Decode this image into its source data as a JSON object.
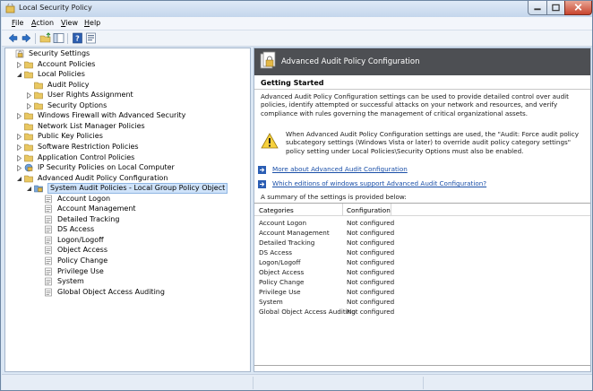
{
  "window": {
    "title": "Local Security Policy"
  },
  "menu": [
    {
      "label": "File",
      "accel": "F",
      "rest": "ile"
    },
    {
      "label": "Action",
      "accel": "A",
      "rest": "ction"
    },
    {
      "label": "View",
      "accel": "V",
      "rest": "iew"
    },
    {
      "label": "Help",
      "accel": "H",
      "rest": "elp"
    }
  ],
  "toolbar": {
    "icons": [
      "back-arrow-icon",
      "forward-arrow-icon",
      "up-folder-icon",
      "show-hide-tree-icon",
      "help-icon",
      "properties-icon"
    ]
  },
  "tree": [
    {
      "label": "Security Settings",
      "depth": 0,
      "expander": "none",
      "icon": "security-settings-icon"
    },
    {
      "label": "Account Policies",
      "depth": 1,
      "expander": "collapsed",
      "icon": "folder-icon"
    },
    {
      "label": "Local Policies",
      "depth": 1,
      "expander": "expanded",
      "icon": "folder-icon"
    },
    {
      "label": "Audit Policy",
      "depth": 2,
      "expander": "none",
      "icon": "folder-icon"
    },
    {
      "label": "User Rights Assignment",
      "depth": 2,
      "expander": "collapsed",
      "icon": "folder-icon"
    },
    {
      "label": "Security Options",
      "depth": 2,
      "expander": "collapsed",
      "icon": "folder-icon"
    },
    {
      "label": "Windows Firewall with Advanced Security",
      "depth": 1,
      "expander": "collapsed",
      "icon": "folder-icon"
    },
    {
      "label": "Network List Manager Policies",
      "depth": 1,
      "expander": "none",
      "icon": "folder-icon"
    },
    {
      "label": "Public Key Policies",
      "depth": 1,
      "expander": "collapsed",
      "icon": "folder-icon"
    },
    {
      "label": "Software Restriction Policies",
      "depth": 1,
      "expander": "collapsed",
      "icon": "folder-icon"
    },
    {
      "label": "Application Control Policies",
      "depth": 1,
      "expander": "collapsed",
      "icon": "folder-icon"
    },
    {
      "label": "IP Security Policies on Local Computer",
      "depth": 1,
      "expander": "collapsed",
      "icon": "ipsec-icon"
    },
    {
      "label": "Advanced Audit Policy Configuration",
      "depth": 1,
      "expander": "expanded",
      "icon": "folder-icon"
    },
    {
      "label": "System Audit Policies - Local Group Policy Object",
      "depth": 2,
      "expander": "expanded",
      "icon": "audit-policy-icon",
      "selected": true
    },
    {
      "label": "Account Logon",
      "depth": 3,
      "expander": "none",
      "icon": "policy-page-icon"
    },
    {
      "label": "Account Management",
      "depth": 3,
      "expander": "none",
      "icon": "policy-page-icon"
    },
    {
      "label": "Detailed Tracking",
      "depth": 3,
      "expander": "none",
      "icon": "policy-page-icon"
    },
    {
      "label": "DS Access",
      "depth": 3,
      "expander": "none",
      "icon": "policy-page-icon"
    },
    {
      "label": "Logon/Logoff",
      "depth": 3,
      "expander": "none",
      "icon": "policy-page-icon"
    },
    {
      "label": "Object Access",
      "depth": 3,
      "expander": "none",
      "icon": "policy-page-icon"
    },
    {
      "label": "Policy Change",
      "depth": 3,
      "expander": "none",
      "icon": "policy-page-icon"
    },
    {
      "label": "Privilege Use",
      "depth": 3,
      "expander": "none",
      "icon": "policy-page-icon"
    },
    {
      "label": "System",
      "depth": 3,
      "expander": "none",
      "icon": "policy-page-icon"
    },
    {
      "label": "Global Object Access Auditing",
      "depth": 3,
      "expander": "none",
      "icon": "policy-page-icon"
    }
  ],
  "right": {
    "header_title": "Advanced Audit Policy Configuration",
    "section_title": "Getting Started",
    "intro": "Advanced Audit Policy Configuration settings can be used to provide detailed control over audit policies, identify attempted or successful attacks on your network and resources, and verify compliance with rules governing the management of critical organizational assets.",
    "warning": "When Advanced Audit Policy Configuration settings are used, the \"Audit: Force audit policy subcategory settings (Windows Vista or later) to override audit policy category settings\" policy setting under Local Policies\\Security Options must also be enabled.",
    "links": [
      "More about Advanced Audit Configuration",
      "Which editions of windows support Advanced Audit Configuration?"
    ],
    "summary": "A summary of the settings is provided below:",
    "table": {
      "headers": [
        "Categories",
        "Configuration"
      ],
      "rows": [
        [
          "Account Logon",
          "Not configured"
        ],
        [
          "Account Management",
          "Not configured"
        ],
        [
          "Detailed Tracking",
          "Not configured"
        ],
        [
          "DS Access",
          "Not configured"
        ],
        [
          "Logon/Logoff",
          "Not configured"
        ],
        [
          "Object Access",
          "Not configured"
        ],
        [
          "Policy Change",
          "Not configured"
        ],
        [
          "Privilege Use",
          "Not configured"
        ],
        [
          "System",
          "Not configured"
        ],
        [
          "Global Object Access Auditing",
          "Not configured"
        ]
      ]
    }
  }
}
